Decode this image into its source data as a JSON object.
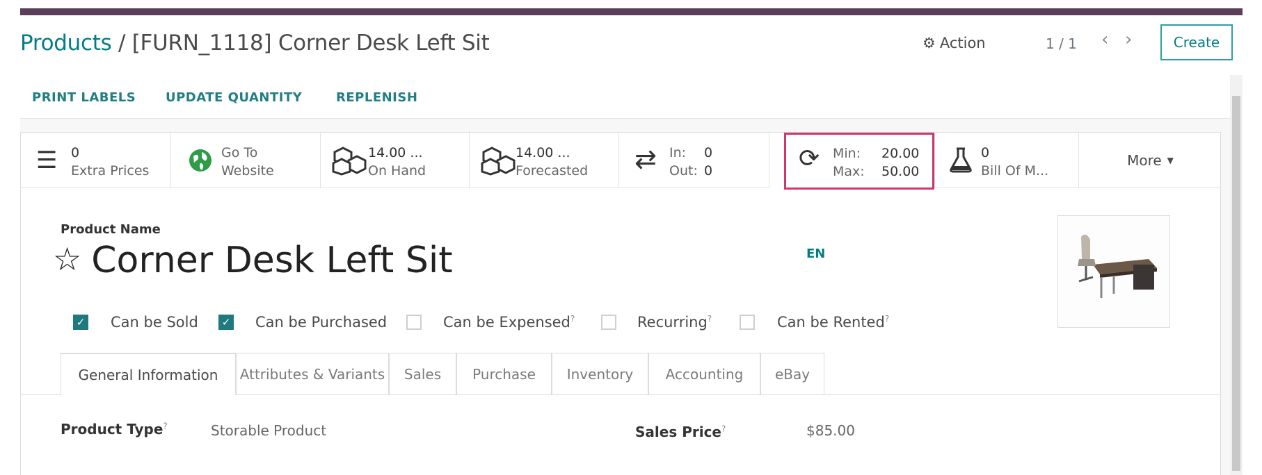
{
  "breadcrumb": {
    "parent": "Products",
    "separator": " / ",
    "current": "[FURN_1118] Corner Desk Left Sit"
  },
  "control": {
    "action_label": "Action",
    "pager": "1 / 1",
    "create_label": "Create"
  },
  "status_buttons": [
    "PRINT LABELS",
    "UPDATE QUANTITY",
    "REPLENISH"
  ],
  "smart_buttons": {
    "extra_prices": {
      "value": "0",
      "label": "Extra Prices"
    },
    "website": {
      "value": "Go To",
      "label": "Website"
    },
    "on_hand": {
      "value": "14.00 ...",
      "label": "On Hand"
    },
    "forecasted": {
      "value": "14.00 ...",
      "label": "Forecasted"
    },
    "in_out": {
      "in_label": "In:",
      "in_value": "0",
      "out_label": "Out:",
      "out_value": "0"
    },
    "min_max": {
      "min_label": "Min:",
      "min_value": "20.00",
      "max_label": "Max:",
      "max_value": "50.00"
    },
    "bom": {
      "value": "0",
      "label": "Bill Of M..."
    },
    "more": "More"
  },
  "product": {
    "name_label": "Product Name",
    "name": "Corner Desk Left Sit",
    "lang": "EN",
    "checkboxes": [
      {
        "label": "Can be Sold",
        "checked": true
      },
      {
        "label": "Can be Purchased",
        "checked": true
      },
      {
        "label": "Can be Expensed",
        "checked": false
      },
      {
        "label": "Recurring",
        "checked": false
      },
      {
        "label": "Can be Rented",
        "checked": false
      }
    ]
  },
  "tabs": [
    "General Information",
    "Attributes & Variants",
    "Sales",
    "Purchase",
    "Inventory",
    "Accounting",
    "eBay"
  ],
  "general": {
    "product_type_label": "Product Type",
    "product_type": "Storable Product",
    "sales_price_label": "Sales Price",
    "sales_price": "$85.00"
  },
  "colors": {
    "brand": "#5b3e58",
    "link": "#017e84",
    "highlight": "#d0366a",
    "checkbox": "#1f7a7e"
  }
}
